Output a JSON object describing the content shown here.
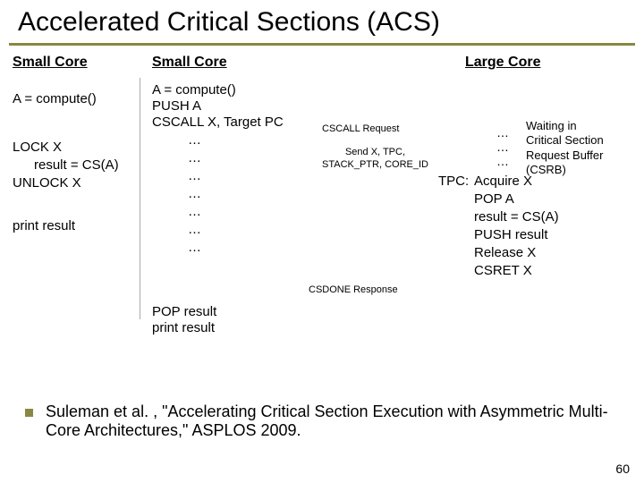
{
  "title": "Accelerated Critical Sections (ACS)",
  "headers": {
    "small1": "Small Core",
    "small2": "Small Core",
    "large": "Large Core"
  },
  "left": {
    "l1": "A = compute()",
    "l2": "LOCK X",
    "l3": "result = CS(A)",
    "l4": "UNLOCK X",
    "l5": "print result"
  },
  "mid": {
    "m1": "A = compute()",
    "m2": "PUSH A",
    "m3": "CSCALL X, Target PC",
    "dots1": "…",
    "dots2": "…",
    "dots3": "…",
    "dots4": "…",
    "dots5": "…",
    "dots6": "…",
    "dots7": "…",
    "m4": "POP result",
    "m5": "print result"
  },
  "msgs": {
    "req": "CSCALL Request",
    "send": "Send X, TPC,\nSTACK_PTR, CORE_ID",
    "resp": "CSDONE Response"
  },
  "buf": {
    "d1": "…",
    "d2": "…",
    "d3": "…",
    "wait": "Waiting in\nCritical Section\nRequest Buffer\n(CSRB)"
  },
  "tpc": {
    "t0": "TPC:",
    "t1": "Acquire X",
    "t2": "POP A",
    "t3": "result  = CS(A)",
    "t4": "PUSH result",
    "t5": "Release X",
    "t6": "CSRET X"
  },
  "cite": "Suleman et al. , \"Accelerating Critical Section Execution with Asymmetric Multi-Core Architectures,\" ASPLOS 2009.",
  "page": "60"
}
